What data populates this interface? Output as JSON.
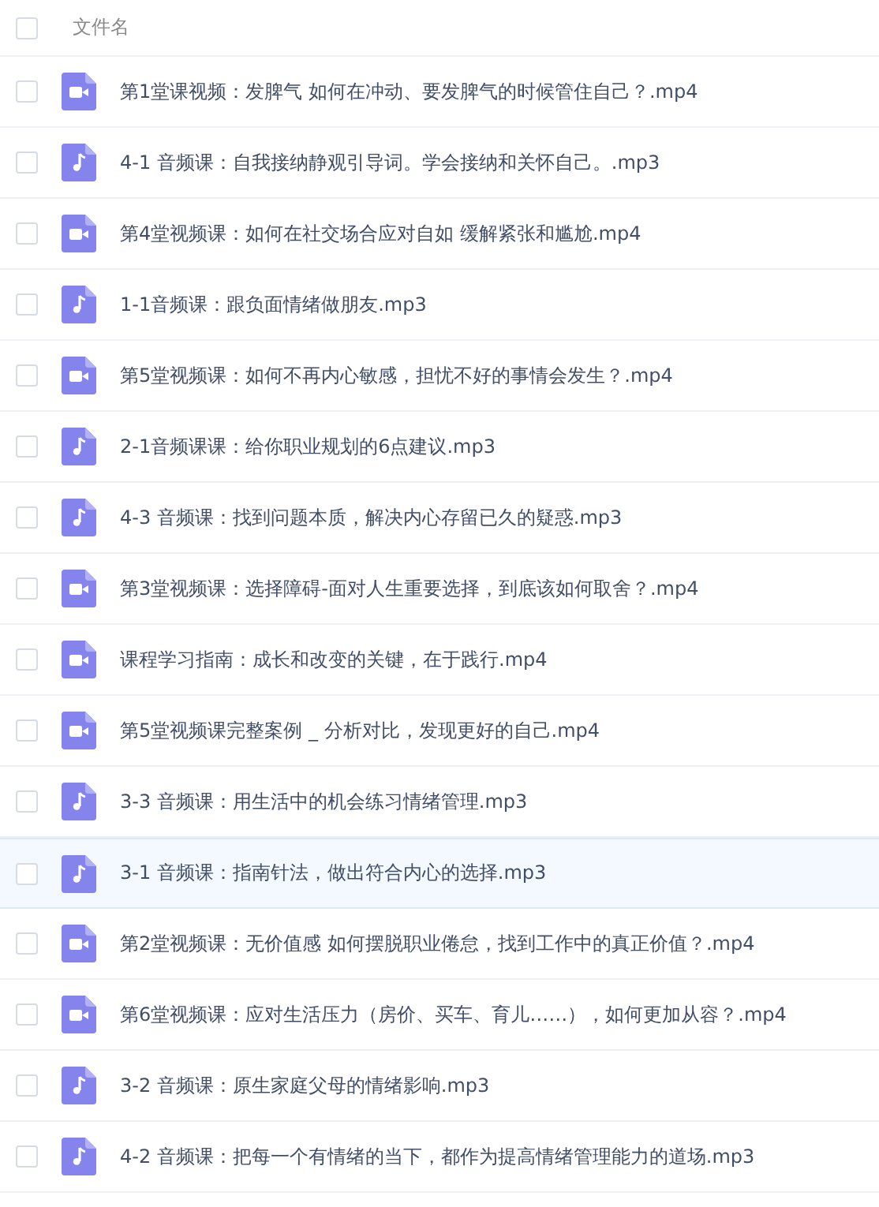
{
  "header": {
    "checked": false,
    "label": "文件名"
  },
  "files": [
    {
      "kind": "video",
      "name": "第1堂课视频：发脾气 如何在冲动、要发脾气的时候管住自己？.mp4",
      "checked": false,
      "highlighted": false
    },
    {
      "kind": "audio",
      "name": "4-1 音频课：自我接纳静观引导词。学会接纳和关怀自己。.mp3",
      "checked": false,
      "highlighted": false
    },
    {
      "kind": "video",
      "name": "第4堂视频课：如何在社交场合应对自如 缓解紧张和尴尬.mp4",
      "checked": false,
      "highlighted": false
    },
    {
      "kind": "audio",
      "name": "1-1音频课：跟负面情绪做朋友.mp3",
      "checked": false,
      "highlighted": false
    },
    {
      "kind": "video",
      "name": "第5堂视频课：如何不再内心敏感，担忧不好的事情会发生？.mp4",
      "checked": false,
      "highlighted": false
    },
    {
      "kind": "audio",
      "name": "2-1音频课课：给你职业规划的6点建议.mp3",
      "checked": false,
      "highlighted": false
    },
    {
      "kind": "audio",
      "name": "4-3 音频课：找到问题本质，解决内心存留已久的疑惑.mp3",
      "checked": false,
      "highlighted": false
    },
    {
      "kind": "video",
      "name": "第3堂视频课：选择障碍-面对人生重要选择，到底该如何取舍？.mp4",
      "checked": false,
      "highlighted": false
    },
    {
      "kind": "video",
      "name": "课程学习指南：成长和改变的关键，在于践行.mp4",
      "checked": false,
      "highlighted": false
    },
    {
      "kind": "video",
      "name": "第5堂视频课完整案例 _ 分析对比，发现更好的自己.mp4",
      "checked": false,
      "highlighted": false
    },
    {
      "kind": "audio",
      "name": "3-3 音频课：用生活中的机会练习情绪管理.mp3",
      "checked": false,
      "highlighted": false
    },
    {
      "kind": "audio",
      "name": "3-1 音频课：指南针法，做出符合内心的选择.mp3",
      "checked": false,
      "highlighted": true
    },
    {
      "kind": "video",
      "name": "第2堂视频课：无价值感 如何摆脱职业倦怠，找到工作中的真正价值？.mp4",
      "checked": false,
      "highlighted": false
    },
    {
      "kind": "video",
      "name": "第6堂视频课：应对生活压力（房价、买车、育儿……），如何更加从容？.mp4",
      "checked": false,
      "highlighted": false
    },
    {
      "kind": "audio",
      "name": "3-2 音频课：原生家庭父母的情绪影响.mp3",
      "checked": false,
      "highlighted": false
    },
    {
      "kind": "audio",
      "name": "4-2 音频课：把每一个有情绪的当下，都作为提高情绪管理能力的道场.mp3",
      "checked": false,
      "highlighted": false
    }
  ]
}
